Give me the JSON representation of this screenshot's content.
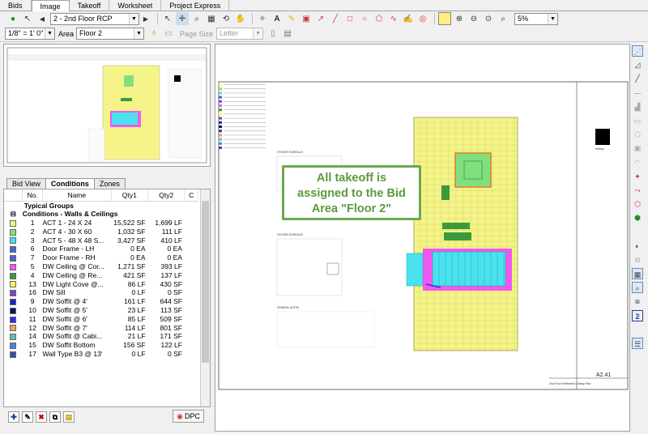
{
  "tabs": [
    "Bids",
    "Image",
    "Takeoff",
    "Worksheet",
    "Project Express"
  ],
  "active_tab": "Image",
  "toolbar": {
    "page_select": "2 - 2nd Floor RCP",
    "zoom_select": "5%",
    "scale_select": "1/8\" = 1' 0\"",
    "area_label": "Area",
    "area_select": "Floor 2",
    "page_size_label": "Page Size",
    "page_size_select": "Letter"
  },
  "left_tabs": [
    "Bid View",
    "Conditions",
    "Zones"
  ],
  "grid": {
    "headers": [
      "No.",
      "Name",
      "Qty1",
      "Qty2",
      "C"
    ],
    "group_typical": "Typical Groups",
    "group_conditions": "Conditions - Walls & Ceilings",
    "rows": [
      {
        "no": "1",
        "name": "ACT 1 - 24 X 24",
        "qty1": "15,522 SF",
        "qty2": "1,699 LF",
        "color": "#f4f488"
      },
      {
        "no": "2",
        "name": "ACT 4 - 30 X 60",
        "qty1": "1,032 SF",
        "qty2": "111 LF",
        "color": "#80e080"
      },
      {
        "no": "3",
        "name": "ACT 5 - 48 X 48 S...",
        "qty1": "3,427 SF",
        "qty2": "410 LF",
        "color": "#4ae2ee"
      },
      {
        "no": "6",
        "name": "Door Frame - LH",
        "qty1": "0 EA",
        "qty2": "0 EA",
        "color": "#5060d8"
      },
      {
        "no": "7",
        "name": "Door Frame - RH",
        "qty1": "0 EA",
        "qty2": "0 EA",
        "color": "#5060d8"
      },
      {
        "no": "5",
        "name": "DW Ceiling @ Cor...",
        "qty1": "1,271 SF",
        "qty2": "393 LF",
        "color": "#f058f0"
      },
      {
        "no": "4",
        "name": "DW Ceiling @ Re...",
        "qty1": "421 SF",
        "qty2": "137 LF",
        "color": "#3a9a3a"
      },
      {
        "no": "13",
        "name": "DW Light Cove @...",
        "qty1": "86 LF",
        "qty2": "430 SF",
        "color": "#f8f860"
      },
      {
        "no": "16",
        "name": "DW Sill",
        "qty1": "0 LF",
        "qty2": "0 SF",
        "color": "#8040d0"
      },
      {
        "no": "9",
        "name": "DW Soffit @ 4'",
        "qty1": "161 LF",
        "qty2": "644 SF",
        "color": "#2020c0"
      },
      {
        "no": "10",
        "name": "DW Soffit @ 5'",
        "qty1": "23 LF",
        "qty2": "113 SF",
        "color": "#101060"
      },
      {
        "no": "11",
        "name": "DW Soffit @ 6'",
        "qty1": "85 LF",
        "qty2": "509 SF",
        "color": "#3030e0"
      },
      {
        "no": "12",
        "name": "DW Soffit @ 7'",
        "qty1": "114 LF",
        "qty2": "801 SF",
        "color": "#f0a060"
      },
      {
        "no": "14",
        "name": "DW Soffit @ Cabi...",
        "qty1": "21 LF",
        "qty2": "171 SF",
        "color": "#60c0b0"
      },
      {
        "no": "15",
        "name": "DW Soffit Bottom",
        "qty1": "156 SF",
        "qty2": "122 LF",
        "color": "#5080e0"
      },
      {
        "no": "17",
        "name": "Wall Type B3 @ 13'",
        "qty1": "0 LF",
        "qty2": "0 SF",
        "color": "#3050b0"
      }
    ]
  },
  "dpc_label": "DPC",
  "callout": {
    "line1": "All takeoff is",
    "line2": "assigned to the Bid",
    "line3": "Area \"Floor 2\""
  },
  "sheet": {
    "title": "2nd Floor Reflected Ceiling Plan",
    "sheet_no": "A2.41",
    "firm": "Kirksey"
  },
  "colors": {
    "accent_green": "#6aa84f",
    "ceiling_yellow": "#f4f488",
    "ceiling_cyan": "#4ae2ee",
    "ceiling_magenta": "#f058f0"
  }
}
